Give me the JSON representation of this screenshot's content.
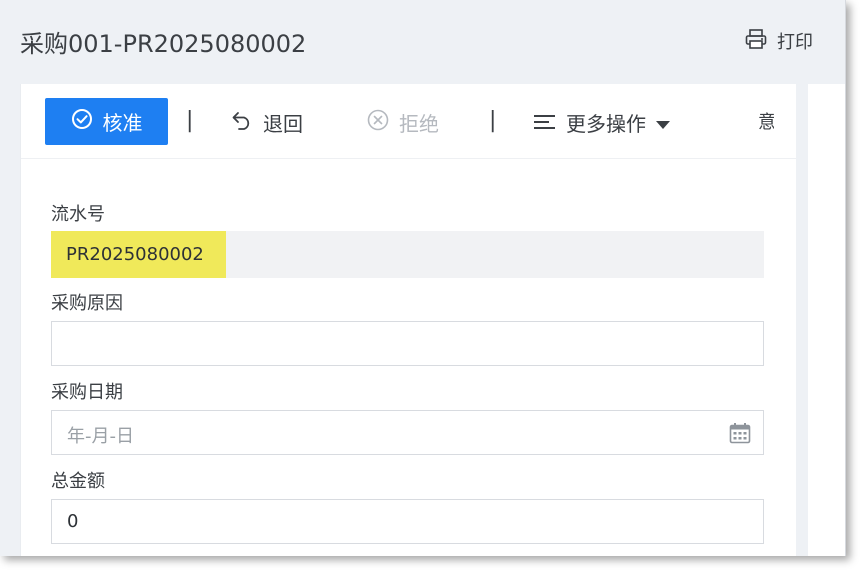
{
  "header": {
    "title": "采购001-PR2025080002",
    "print_label": "打印"
  },
  "toolbar": {
    "approve_label": "核准",
    "separator": "|",
    "return_label": "退回",
    "reject_label": "拒绝",
    "more_label": "更多操作",
    "edge_label": "意"
  },
  "form": {
    "serial": {
      "label": "流水号",
      "value": "PR2025080002"
    },
    "reason": {
      "label": "采购原因",
      "value": ""
    },
    "date": {
      "label": "采购日期",
      "placeholder": "年-月-日"
    },
    "total": {
      "label": "总金额",
      "value": "0"
    }
  },
  "colors": {
    "primary": "#1e7ff2",
    "highlight": "#f0e95a",
    "text": "#3b3f44",
    "disabled": "#b5b9bf"
  },
  "icons": {
    "print": "printer-icon",
    "approve": "check-circle-icon",
    "return": "undo-icon",
    "reject": "x-circle-icon",
    "more": "menu-lines-icon",
    "dropdown": "caret-down-icon",
    "calendar": "calendar-icon"
  }
}
